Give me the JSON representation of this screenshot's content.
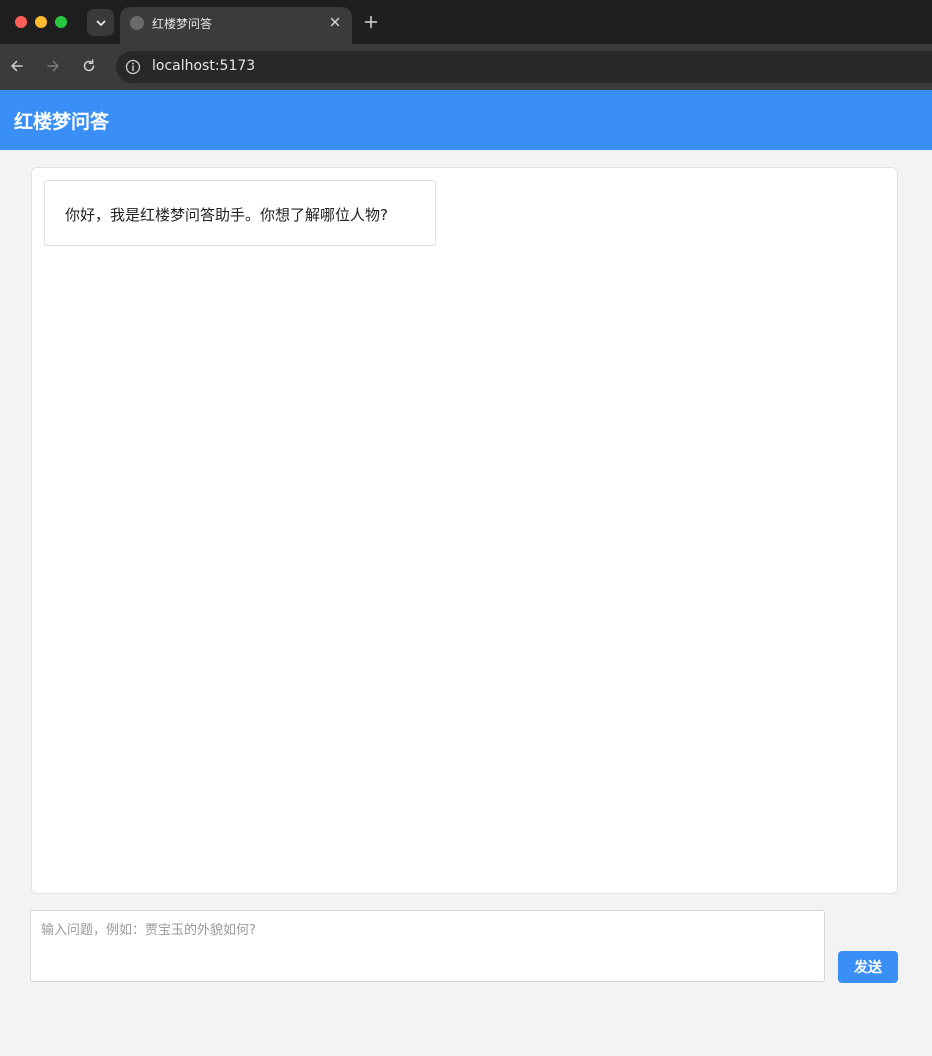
{
  "browser": {
    "tab_title": "红楼梦问答",
    "url": "localhost:5173"
  },
  "header": {
    "title": "红楼梦问答",
    "background_color": "#3a8ff6"
  },
  "chat": {
    "messages": [
      {
        "role": "assistant",
        "text": "你好，我是红楼梦问答助手。你想了解哪位人物?"
      }
    ]
  },
  "input": {
    "value": "",
    "placeholder": "输入问题，例如：贾宝玉的外貌如何?"
  },
  "send_button": {
    "label": "发送"
  }
}
